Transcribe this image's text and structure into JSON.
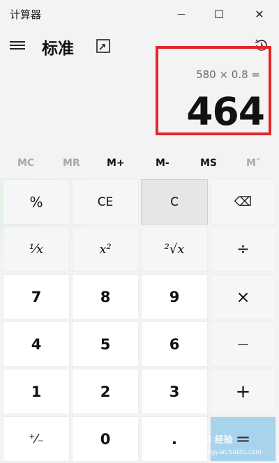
{
  "titlebar": {
    "app_title": "计算器",
    "minimize": "—",
    "maximize": "☐",
    "close": "✕"
  },
  "header": {
    "mode_title": "标准"
  },
  "display": {
    "expression": "580 × 0.8 =",
    "result": "464"
  },
  "memory": {
    "mc": "MC",
    "mr": "MR",
    "m_plus": "M+",
    "m_minus": "M-",
    "ms": "MS",
    "m_list": "M˅"
  },
  "keys": {
    "percent": "%",
    "ce": "CE",
    "c": "C",
    "backspace": "⌫",
    "reciprocal": "¹⁄x",
    "square": "x²",
    "sqrt": "²√x",
    "divide": "÷",
    "seven": "7",
    "eight": "8",
    "nine": "9",
    "multiply": "×",
    "four": "4",
    "five": "5",
    "six": "6",
    "minus": "—",
    "one": "1",
    "two": "2",
    "three": "3",
    "plus": "+",
    "negate": "⁺⁄₋",
    "zero": "0",
    "decimal": ".",
    "equals": "="
  },
  "watermark": {
    "brand": "Bai 经验",
    "url": "jingyan.baidu.com"
  },
  "colors": {
    "highlight_border": "#e3262c",
    "equals_key": "#a7d3ec",
    "background": "#f2f3f2"
  }
}
